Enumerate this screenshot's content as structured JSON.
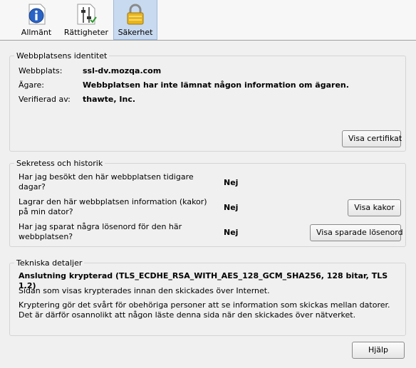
{
  "tabs": [
    {
      "label": "Allmänt",
      "icon": "info-icon"
    },
    {
      "label": "Rättigheter",
      "icon": "permissions-sliders-icon"
    },
    {
      "label": "Säkerhet",
      "icon": "padlock-icon",
      "selected": true
    }
  ],
  "identity": {
    "title": "Webbplatsens identitet",
    "website_label": "Webbplats:",
    "website_value": "ssl-dv.mozqa.com",
    "owner_label": "Ägare:",
    "owner_value": "Webbplatsen har inte lämnat någon information om ägaren.",
    "verified_label": "Verifierad av:",
    "verified_value": "thawte, Inc.",
    "view_cert_button": "Visa certifikat"
  },
  "privacy": {
    "title": "Sekretess och historik",
    "q1": "Har jag besökt den här webbplatsen tidigare dagar?",
    "a1": "Nej",
    "q2": "Lagrar den här webbplatsen information (kakor) på min dator?",
    "a2": "Nej",
    "cookies_button": "Visa kakor",
    "q3": "Har jag sparat några lösenord för den här webbplatsen?",
    "a3": "Nej",
    "passwords_button": "Visa sparade lösenord"
  },
  "tech": {
    "title": "Tekniska detaljer",
    "connection": "Anslutning krypterad (TLS_ECDHE_RSA_WITH_AES_128_GCM_SHA256, 128 bitar, TLS 1.2)",
    "line1": "Sidan som visas krypterades innan den skickades över Internet.",
    "line2": "Kryptering gör det svårt för obehöriga personer att se information som skickas mellan datorer. Det är därför osannolikt att någon läste denna sida när den skickades över nätverket."
  },
  "help_button": "Hjälp"
}
